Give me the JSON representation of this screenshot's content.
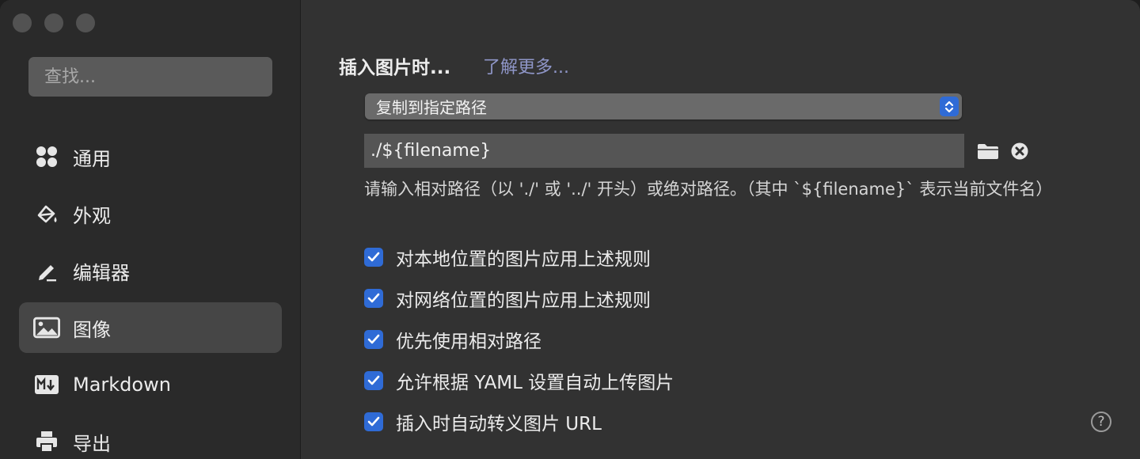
{
  "sidebar": {
    "search_placeholder": "查找...",
    "items": [
      {
        "label": "通用",
        "icon": "grid-icon",
        "active": false
      },
      {
        "label": "外观",
        "icon": "paint-bucket-icon",
        "active": false
      },
      {
        "label": "编辑器",
        "icon": "pencil-icon",
        "active": false
      },
      {
        "label": "图像",
        "icon": "image-icon",
        "active": true
      },
      {
        "label": "Markdown",
        "icon": "markdown-icon",
        "active": false
      },
      {
        "label": "导出",
        "icon": "printer-icon",
        "active": false
      }
    ]
  },
  "content": {
    "heading": "插入图片时...",
    "learn_more": "了解更多...",
    "select_value": "复制到指定路径",
    "path_value": "./${filename}",
    "hint": "请输入相对路径（以 './' 或 '../' 开头）或绝对路径。（其中 `${filename}` 表示当前文件名）",
    "checkboxes": [
      {
        "label": "对本地位置的图片应用上述规则",
        "checked": true
      },
      {
        "label": "对网络位置的图片应用上述规则",
        "checked": true
      },
      {
        "label": "优先使用相对路径",
        "checked": true
      },
      {
        "label": "允许根据 YAML 设置自动上传图片",
        "checked": true
      },
      {
        "label": "插入时自动转义图片 URL",
        "checked": true
      }
    ],
    "help_label": "?"
  },
  "colors": {
    "accent": "#2f6bd6",
    "link": "#8f96c8",
    "sidebar_bg": "#2a2a2a",
    "content_bg": "#323232"
  }
}
